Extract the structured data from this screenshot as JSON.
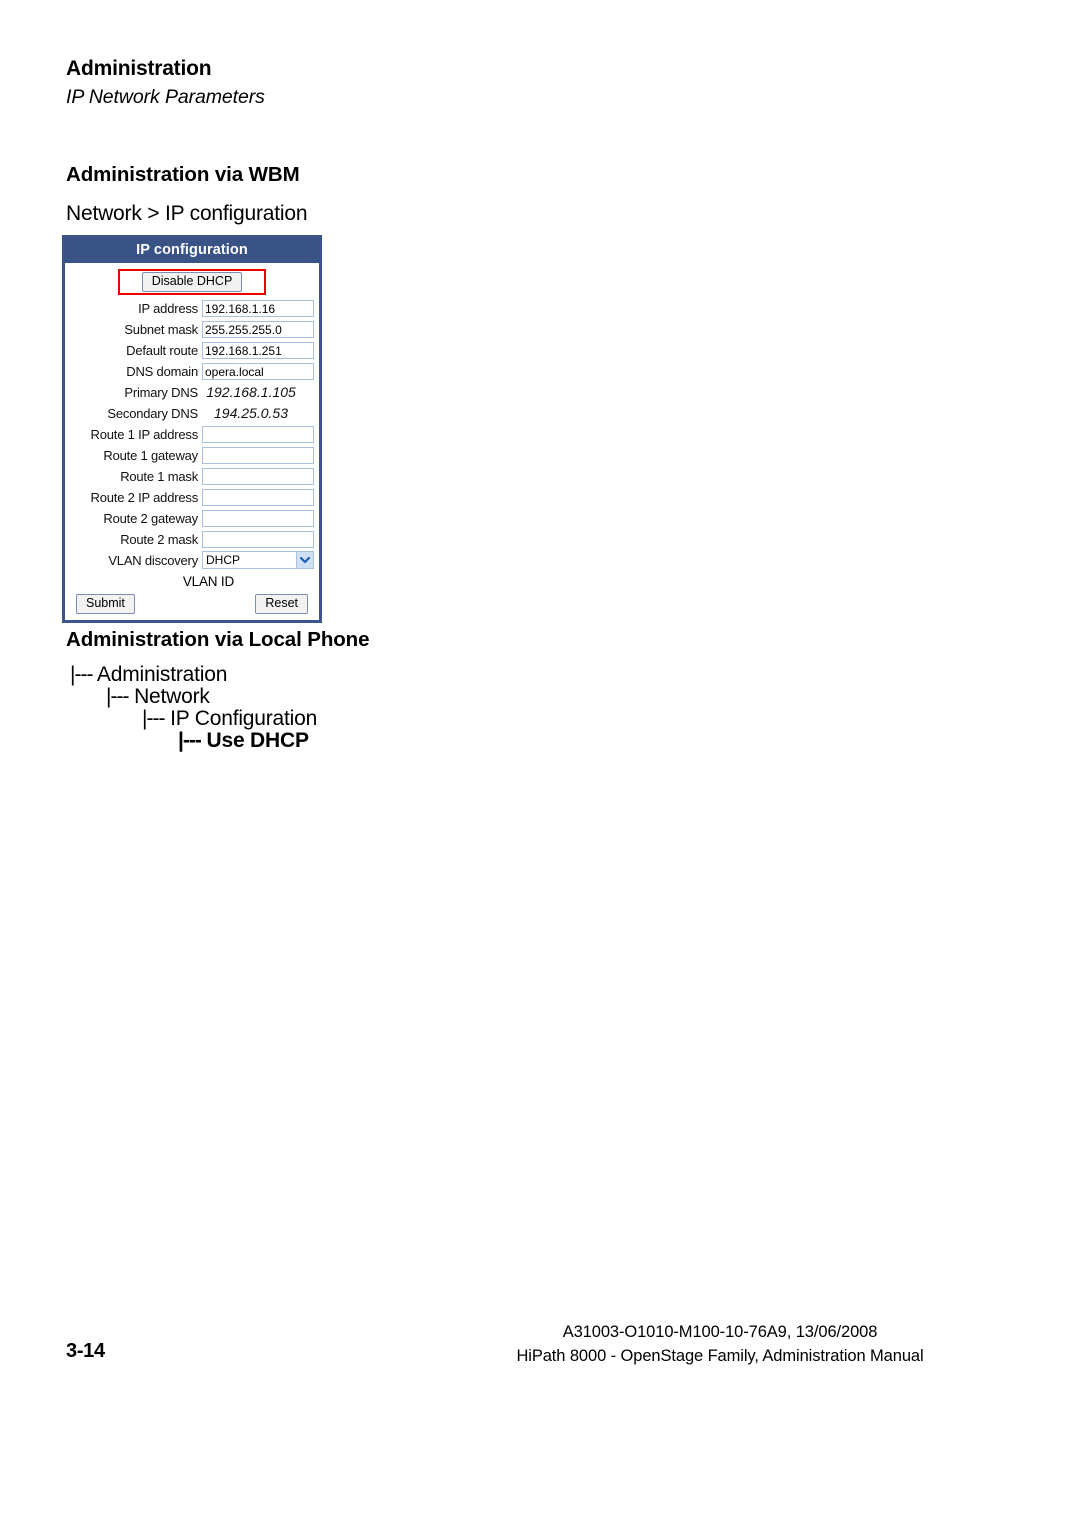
{
  "runhead": {
    "title": "Administration",
    "subtitle": "IP Network Parameters"
  },
  "sections": {
    "wbm_heading": "Administration via WBM",
    "wbm_path": "Network > IP configuration",
    "phone_heading": "Administration via Local Phone"
  },
  "dialog": {
    "title": "IP configuration",
    "dhcp_button": "Disable DHCP",
    "submit_label": "Submit",
    "reset_label": "Reset",
    "highlight_color": "#ee0000",
    "titlebar_color": "#3a5387",
    "border_color": "#3c5488",
    "field_border_color": "#a8c0dd",
    "fields": [
      {
        "label": "IP address",
        "value": "192.168.1.16",
        "type": "input"
      },
      {
        "label": "Subnet mask",
        "value": "255.255.255.0",
        "type": "input"
      },
      {
        "label": "Default route",
        "value": "192.168.1.251",
        "type": "input"
      },
      {
        "label": "DNS domain",
        "value": "opera.local",
        "type": "input"
      },
      {
        "label": "Primary DNS",
        "value": "192.168.1.105",
        "type": "static"
      },
      {
        "label": "Secondary DNS",
        "value": "194.25.0.53",
        "type": "static"
      },
      {
        "label": "Route 1 IP address",
        "value": "",
        "type": "input"
      },
      {
        "label": "Route 1 gateway",
        "value": "",
        "type": "input"
      },
      {
        "label": "Route 1 mask",
        "value": "",
        "type": "input"
      },
      {
        "label": "Route 2 IP address",
        "value": "",
        "type": "input"
      },
      {
        "label": "Route 2 gateway",
        "value": "",
        "type": "input"
      },
      {
        "label": "Route 2 mask",
        "value": "",
        "type": "input"
      },
      {
        "label": "VLAN discovery",
        "value": "DHCP",
        "type": "select"
      },
      {
        "label": "VLAN ID",
        "value": "",
        "type": "none"
      }
    ]
  },
  "tree": {
    "prefix": "|---",
    "items": [
      {
        "label": "Administration",
        "bold": false
      },
      {
        "label": "Network",
        "bold": false
      },
      {
        "label": "IP Configuration",
        "bold": false
      },
      {
        "label": "Use DHCP",
        "bold": true
      }
    ]
  },
  "footer": {
    "page_number": "3-14",
    "doc_id": "A31003-O1010-M100-10-76A9, 13/06/2008",
    "doc_title": "HiPath 8000 - OpenStage Family, Administration Manual"
  }
}
